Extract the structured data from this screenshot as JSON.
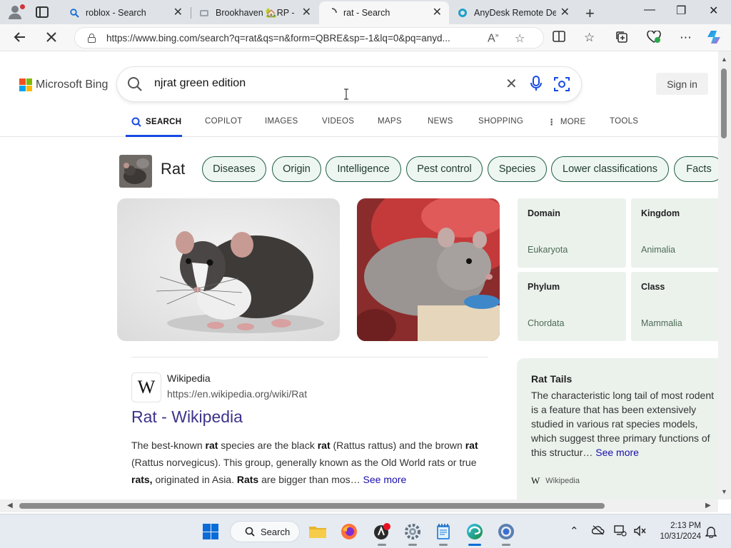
{
  "browser": {
    "tabs": [
      {
        "title": "roblox - Search",
        "icon": "search-icon"
      },
      {
        "title": "Brookhaven 🏡RP - Roblox",
        "icon": "roblox-icon"
      },
      {
        "title": "rat - Search",
        "icon": "search-icon",
        "active": true
      },
      {
        "title": "AnyDesk Remote Desktop",
        "icon": "anydesk-icon"
      }
    ],
    "address": {
      "url": "https://www.bing.com/search?q=rat&qs=n&form=QBRE&sp=-1&lq=0&pq=anyd..."
    }
  },
  "bing": {
    "logo_text": "Microsoft Bing",
    "search_query": "njrat green edition",
    "signin_label": "Sign in",
    "scopes": [
      "SEARCH",
      "COPILOT",
      "IMAGES",
      "VIDEOS",
      "MAPS",
      "NEWS",
      "SHOPPING",
      "MORE",
      "TOOLS"
    ],
    "entity": {
      "title": "Rat",
      "chips": [
        "Diseases",
        "Origin",
        "Intelligence",
        "Pest control",
        "Species",
        "Lower classifications",
        "Facts"
      ]
    },
    "taxonomy": [
      {
        "label": "Domain",
        "value": "Eukaryota"
      },
      {
        "label": "Kingdom",
        "value": "Animalia"
      },
      {
        "label": "Phylum",
        "value": "Chordata"
      },
      {
        "label": "Class",
        "value": "Mammalia"
      }
    ],
    "result": {
      "badge": "W",
      "source": "Wikipedia",
      "url": "https://en.wikipedia.org/wiki/Rat",
      "title": "Rat - Wikipedia",
      "see_more": "See more"
    },
    "side_card": {
      "title": "Rat Tails",
      "text": "The characteristic long tail of most rodent is a feature that has been extensively studied in various rat species models, which suggest three primary functions of this structur…",
      "see_more": "See more",
      "source_badge": "W",
      "source": "Wikipedia"
    }
  },
  "taskbar": {
    "search_label": "Search",
    "time": "2:13 PM",
    "date": "10/31/2024"
  },
  "colors": {
    "bing_blue": "#174ae4",
    "chip_border": "#1f5f46",
    "card_bg": "#ebf2ec",
    "result_title": "#3d3389"
  }
}
